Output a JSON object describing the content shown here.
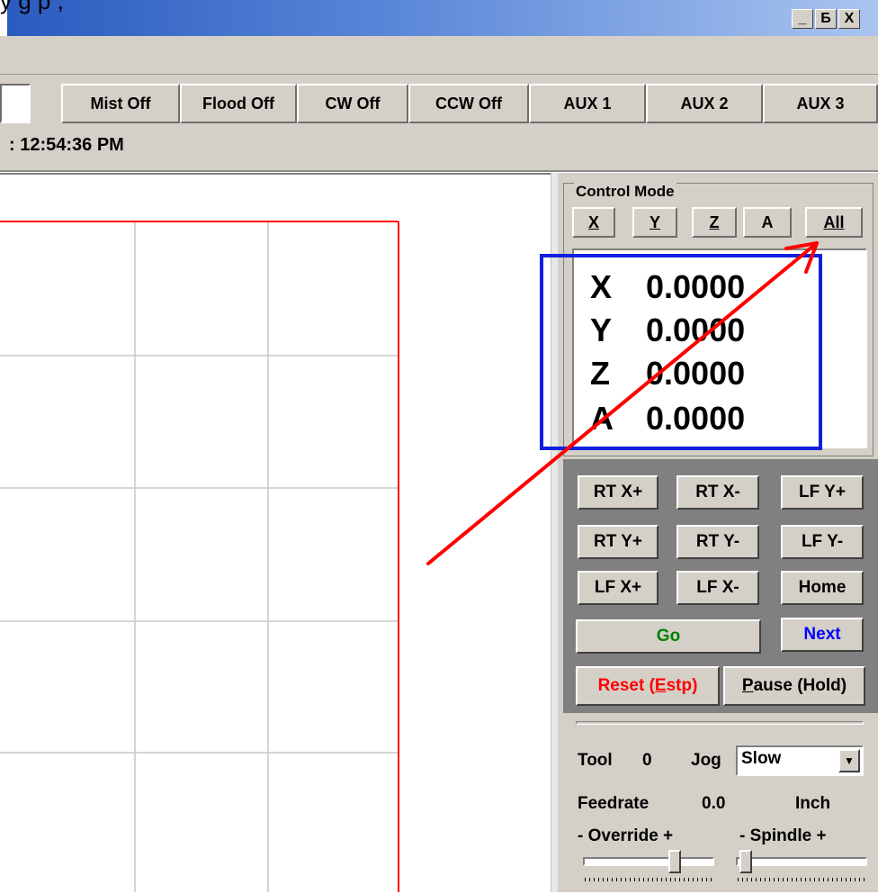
{
  "window": {
    "caption_fragment": "y   g p   ,",
    "controls": {
      "minimize": "_",
      "restore": "Б",
      "close": "X"
    }
  },
  "toolbar": {
    "buttons": [
      "Mist Off",
      "Flood Off",
      "CW Off",
      "CCW Off",
      "AUX 1",
      "AUX 2",
      "AUX 3"
    ]
  },
  "status": {
    "clock": ": 12:54:36 PM"
  },
  "control_mode": {
    "legend": "Control Mode",
    "axis_buttons": [
      "X",
      "Y",
      "Z",
      "A",
      "All"
    ],
    "dro": [
      {
        "axis": "X",
        "value": "0.0000"
      },
      {
        "axis": "Y",
        "value": "0.0000"
      },
      {
        "axis": "Z",
        "value": "0.0000"
      },
      {
        "axis": "A",
        "value": "0.0000"
      }
    ]
  },
  "jog_buttons": {
    "row1": [
      "RT X+",
      "RT X-",
      "LF Y+"
    ],
    "row2": [
      "RT Y+",
      "RT Y-",
      "LF Y-"
    ],
    "row3": [
      "LF X+",
      "LF X-",
      "Home"
    ],
    "go": "Go",
    "next": "Next",
    "reset_prefix": "Reset (",
    "reset_mnemonic": "E",
    "reset_suffix": "stp)",
    "pause_mnemonic": "P",
    "pause_suffix": "ause (Hold)"
  },
  "settings": {
    "tool_label": "Tool",
    "tool_value": "0",
    "jog_label": "Jog",
    "jog_value": "Slow",
    "feedrate_label": "Feedrate",
    "feedrate_value": "0.0",
    "units": "Inch",
    "override_label": "-   Override  +",
    "spindle_label": "-   Spindle    +",
    "override_level": 0.72,
    "spindle_level": 0.03
  },
  "colors": {
    "go_text": "#008000",
    "next_text": "#0000ff",
    "reset_text": "#ff0000",
    "annotation_arrow": "#ff0000",
    "annotation_box": "#1020e0",
    "plot_border": "#ff0000",
    "grid": "#c8c8c8"
  }
}
